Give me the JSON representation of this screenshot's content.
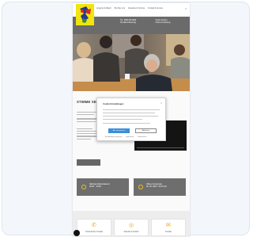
{
  "window": {
    "logo_name": "logo-icon"
  },
  "topnav": {
    "items": [
      "Angebot & Ablauf",
      "Wir über uns",
      "Aktuelles & Termine",
      "Kontakt & Service"
    ]
  },
  "greylinks": {
    "items": [
      "Tel.: 0000 000 0000",
      "Termin buchen",
      "Kontakt & Beratung",
      "Online Anmeldung"
    ]
  },
  "main": {
    "headline": "STIMME SEMINARE FÜR IHRE GEMEINSCHAFT"
  },
  "cards": [
    {
      "line1": "Nächster Erlebnisabend",
      "line2": "00.00. · 00:00"
    },
    {
      "line1": "Offene Kursstunde",
      "line2": "00. 00. 0000 · 00:00 Uhr"
    }
  ],
  "tiles": [
    {
      "label": "Telefonischer Kontakt",
      "icon": "phone-icon"
    },
    {
      "label": "Standort & Anfahrt",
      "icon": "location-icon"
    },
    {
      "label": "Kontakt",
      "icon": "mail-icon"
    }
  ],
  "cookie": {
    "title": "Cookie Einstellungen",
    "accept_label": "Alle akzeptieren",
    "deny_label": "Ablehnen",
    "links": [
      "Einstellungen anpassen",
      "Impressum",
      "Datenschutz"
    ]
  },
  "colors": {
    "brand_yellow": "#f2e40f",
    "accent_orange": "#e6a21a",
    "accept_blue": "#3b8fd9",
    "grey_band": "#6b6b6b"
  }
}
